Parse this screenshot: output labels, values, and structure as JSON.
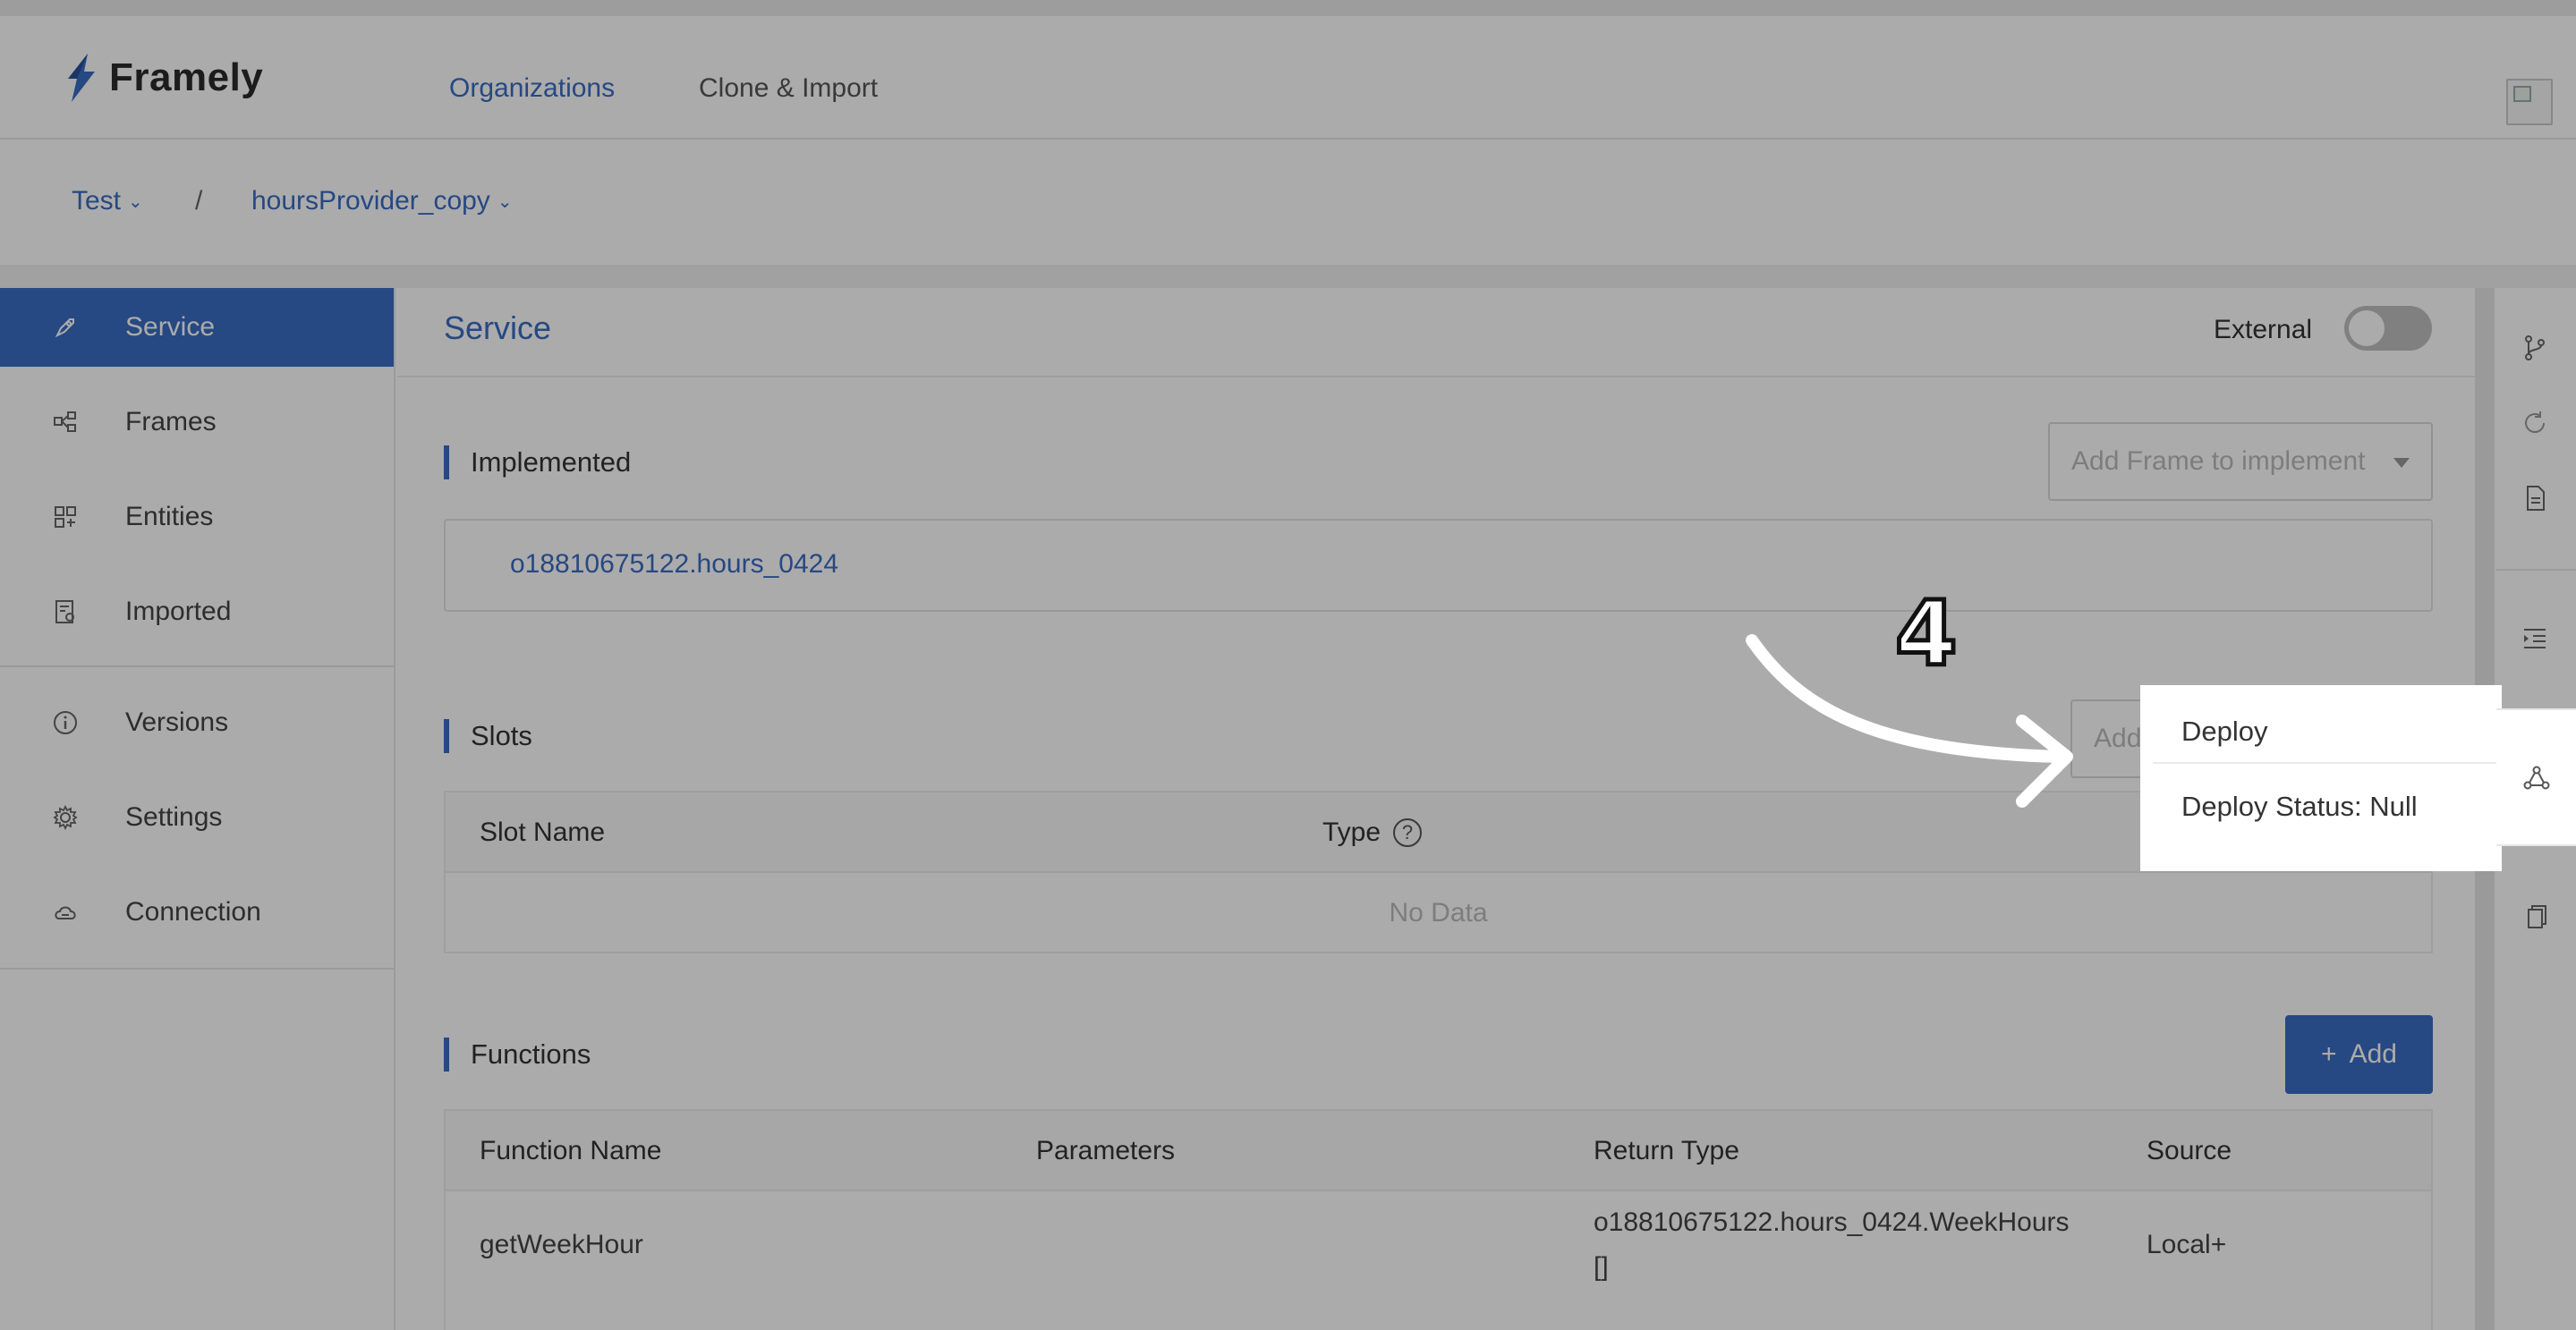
{
  "app": {
    "name": "Framely"
  },
  "header": {
    "tabs": [
      {
        "label": "Organizations",
        "active": true
      },
      {
        "label": "Clone & Import",
        "active": false
      }
    ]
  },
  "breadcrumb": {
    "org": "Test",
    "separator": "/",
    "project": "hoursProvider_copy"
  },
  "sidebar": {
    "items": [
      {
        "label": "Service",
        "icon": "rocket-icon",
        "active": true
      },
      {
        "label": "Frames",
        "icon": "frames-icon"
      },
      {
        "label": "Entities",
        "icon": "entities-icon"
      },
      {
        "label": "Imported",
        "icon": "imported-icon"
      },
      {
        "label": "Versions",
        "icon": "info-icon"
      },
      {
        "label": "Settings",
        "icon": "gear-icon"
      },
      {
        "label": "Connection",
        "icon": "cloud-icon"
      }
    ]
  },
  "main": {
    "title": "Service",
    "external_label": "External",
    "external_on": false,
    "implemented": {
      "title": "Implemented",
      "select_placeholder": "Add Frame to implement",
      "items": [
        "o18810675122.hours_0424"
      ]
    },
    "slots": {
      "title": "Slots",
      "add_placeholder": "Add",
      "columns": [
        "Slot Name",
        "Type"
      ],
      "empty_text": "No Data"
    },
    "functions": {
      "title": "Functions",
      "add_label": "Add",
      "columns": [
        "Function Name",
        "Parameters",
        "Return Type",
        "Source"
      ],
      "rows": [
        {
          "name": "getWeekHour",
          "parameters": "",
          "return_type_line1": "o18810675122.hours_0424.WeekHours",
          "return_type_line2": "[]",
          "source": "Local+"
        }
      ]
    }
  },
  "popup": {
    "items": [
      "Deploy",
      "Deploy Status: Null"
    ]
  },
  "annotation": {
    "step": "4"
  },
  "colors": {
    "accent": "#3a6cc4"
  }
}
